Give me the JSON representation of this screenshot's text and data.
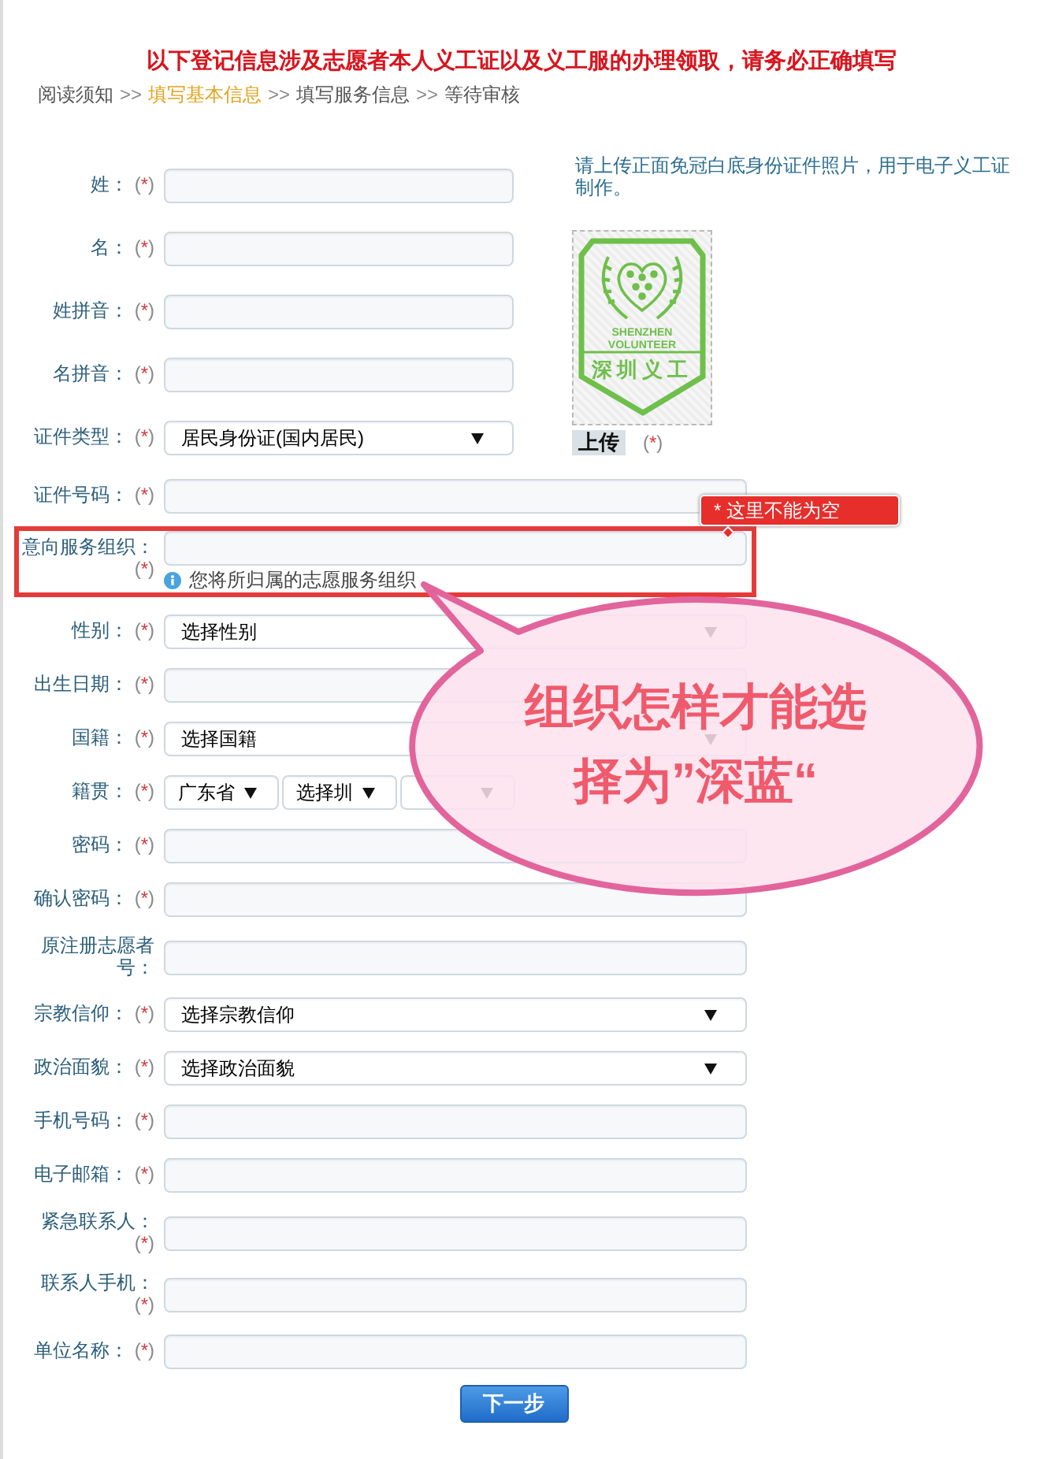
{
  "title": "以下登记信息涉及志愿者本人义工证以及义工服的办理领取，请务必正确填写",
  "breadcrumb": [
    {
      "kind": "step",
      "label": "阅读须知",
      "selected": false
    },
    {
      "kind": "separator",
      "label": ">>"
    },
    {
      "kind": "step",
      "label": "填写基本信息",
      "selected": true
    },
    {
      "kind": "separator",
      "label": ">>"
    },
    {
      "kind": "step",
      "label": "填写服务信息",
      "selected": false
    },
    {
      "kind": "separator",
      "label": ">>"
    },
    {
      "kind": "step",
      "label": "等待审核",
      "selected": false
    }
  ],
  "top_fields": [
    {
      "label": "姓：",
      "required_mark": "(*)",
      "kind": "text",
      "highlighted": false
    },
    {
      "label": "名：",
      "required_mark": "(*)",
      "kind": "text",
      "highlighted": false
    },
    {
      "label": "姓拼音：",
      "required_mark": "(*)",
      "kind": "text",
      "highlighted": false
    },
    {
      "label": "名拼音：",
      "required_mark": "(*)",
      "kind": "text",
      "highlighted": false
    },
    {
      "label": "证件类型：",
      "required_mark": "(*)",
      "kind": "select",
      "value": "居民身份证(国内居民)",
      "highlighted": false
    }
  ],
  "photo_upload": {
    "note": "请上传正面免冠白底身份证件照片，用于电子义工证制作。",
    "logo_lines": [
      "SHENZHEN",
      "VOLUNTEER"
    ],
    "logo_caption": "深圳义工",
    "button": "上传",
    "required_mark": "(*)"
  },
  "fields": [
    {
      "label": "证件号码：",
      "required_mark": "(*)",
      "kind": "text",
      "highlighted": false
    },
    {
      "label": "意向服务组织：",
      "required_mark": "(*)",
      "kind": "text",
      "highlighted": true,
      "error": "* 这里不能为空",
      "hint": "您将所归属的志愿服务组织"
    },
    {
      "label": "性别：",
      "required_mark": "(*)",
      "kind": "select",
      "value": "选择性别",
      "highlighted": false
    },
    {
      "label": "出生日期：",
      "required_mark": "(*)",
      "kind": "text",
      "highlighted": false
    },
    {
      "label": "国籍：",
      "required_mark": "(*)",
      "kind": "select",
      "value": "选择国籍",
      "highlighted": false
    },
    {
      "label": "籍贯：",
      "required_mark": "(*)",
      "kind": "select_group",
      "selects": [
        {
          "kind": "select",
          "value": "广东省"
        },
        {
          "kind": "select",
          "value": "选择圳"
        },
        {
          "kind": "select"
        }
      ],
      "highlighted": false
    },
    {
      "label": "密码：",
      "required_mark": "(*)",
      "kind": "text",
      "highlighted": false
    },
    {
      "label": "确认密码：",
      "required_mark": "(*)",
      "kind": "text",
      "highlighted": false
    },
    {
      "label": "原注册志愿者号：",
      "kind": "text",
      "highlighted": false
    },
    {
      "label": "宗教信仰：",
      "required_mark": "(*)",
      "kind": "select",
      "value": "选择宗教信仰",
      "highlighted": false
    },
    {
      "label": "政治面貌：",
      "required_mark": "(*)",
      "kind": "select",
      "value": "选择政治面貌",
      "highlighted": false
    },
    {
      "label": "手机号码：",
      "required_mark": "(*)",
      "kind": "text",
      "highlighted": false
    },
    {
      "label": "电子邮箱：",
      "required_mark": "(*)",
      "kind": "text",
      "highlighted": false
    },
    {
      "label": "紧急联系人：",
      "required_mark": "(*)",
      "kind": "text",
      "highlighted": false
    },
    {
      "label": "联系人手机：",
      "required_mark": "(*)",
      "kind": "text",
      "highlighted": false
    },
    {
      "label": "单位名称：",
      "required_mark": "(*)",
      "kind": "text",
      "highlighted": false
    }
  ],
  "next_button": "下一步",
  "callout": {
    "lines": [
      "组织怎样才能选",
      "择为”深蓝“"
    ]
  }
}
